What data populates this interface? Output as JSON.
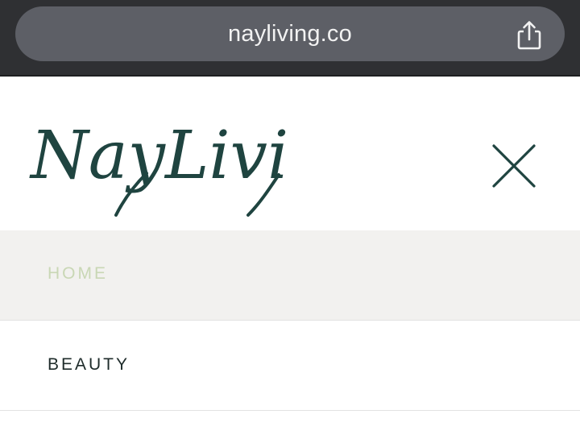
{
  "browser": {
    "url": "nayliving.co",
    "share_icon": "share-icon"
  },
  "site": {
    "logo_text": "NayLiving",
    "close_icon": "close-icon",
    "brand_color": "#1f4440"
  },
  "menu": {
    "items": [
      {
        "label": "HOME",
        "active": true,
        "color": "#c9d7b5"
      },
      {
        "label": "BEAUTY",
        "active": false,
        "color": "#1e2b2a"
      }
    ]
  }
}
